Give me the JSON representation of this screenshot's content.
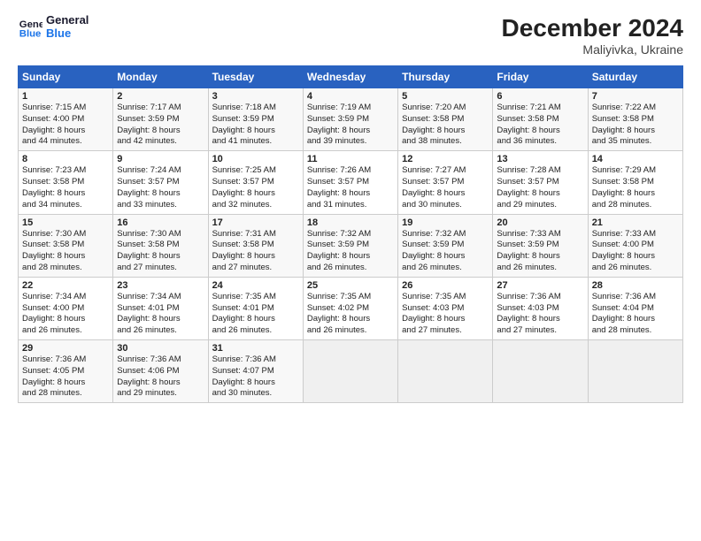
{
  "header": {
    "logo_line1": "General",
    "logo_line2": "Blue",
    "title": "December 2024",
    "subtitle": "Maliyivka, Ukraine"
  },
  "days_of_week": [
    "Sunday",
    "Monday",
    "Tuesday",
    "Wednesday",
    "Thursday",
    "Friday",
    "Saturday"
  ],
  "weeks": [
    [
      {
        "day": "1",
        "info": "Sunrise: 7:15 AM\nSunset: 4:00 PM\nDaylight: 8 hours\nand 44 minutes."
      },
      {
        "day": "2",
        "info": "Sunrise: 7:17 AM\nSunset: 3:59 PM\nDaylight: 8 hours\nand 42 minutes."
      },
      {
        "day": "3",
        "info": "Sunrise: 7:18 AM\nSunset: 3:59 PM\nDaylight: 8 hours\nand 41 minutes."
      },
      {
        "day": "4",
        "info": "Sunrise: 7:19 AM\nSunset: 3:59 PM\nDaylight: 8 hours\nand 39 minutes."
      },
      {
        "day": "5",
        "info": "Sunrise: 7:20 AM\nSunset: 3:58 PM\nDaylight: 8 hours\nand 38 minutes."
      },
      {
        "day": "6",
        "info": "Sunrise: 7:21 AM\nSunset: 3:58 PM\nDaylight: 8 hours\nand 36 minutes."
      },
      {
        "day": "7",
        "info": "Sunrise: 7:22 AM\nSunset: 3:58 PM\nDaylight: 8 hours\nand 35 minutes."
      }
    ],
    [
      {
        "day": "8",
        "info": "Sunrise: 7:23 AM\nSunset: 3:58 PM\nDaylight: 8 hours\nand 34 minutes."
      },
      {
        "day": "9",
        "info": "Sunrise: 7:24 AM\nSunset: 3:57 PM\nDaylight: 8 hours\nand 33 minutes."
      },
      {
        "day": "10",
        "info": "Sunrise: 7:25 AM\nSunset: 3:57 PM\nDaylight: 8 hours\nand 32 minutes."
      },
      {
        "day": "11",
        "info": "Sunrise: 7:26 AM\nSunset: 3:57 PM\nDaylight: 8 hours\nand 31 minutes."
      },
      {
        "day": "12",
        "info": "Sunrise: 7:27 AM\nSunset: 3:57 PM\nDaylight: 8 hours\nand 30 minutes."
      },
      {
        "day": "13",
        "info": "Sunrise: 7:28 AM\nSunset: 3:57 PM\nDaylight: 8 hours\nand 29 minutes."
      },
      {
        "day": "14",
        "info": "Sunrise: 7:29 AM\nSunset: 3:58 PM\nDaylight: 8 hours\nand 28 minutes."
      }
    ],
    [
      {
        "day": "15",
        "info": "Sunrise: 7:30 AM\nSunset: 3:58 PM\nDaylight: 8 hours\nand 28 minutes."
      },
      {
        "day": "16",
        "info": "Sunrise: 7:30 AM\nSunset: 3:58 PM\nDaylight: 8 hours\nand 27 minutes."
      },
      {
        "day": "17",
        "info": "Sunrise: 7:31 AM\nSunset: 3:58 PM\nDaylight: 8 hours\nand 27 minutes."
      },
      {
        "day": "18",
        "info": "Sunrise: 7:32 AM\nSunset: 3:59 PM\nDaylight: 8 hours\nand 26 minutes."
      },
      {
        "day": "19",
        "info": "Sunrise: 7:32 AM\nSunset: 3:59 PM\nDaylight: 8 hours\nand 26 minutes."
      },
      {
        "day": "20",
        "info": "Sunrise: 7:33 AM\nSunset: 3:59 PM\nDaylight: 8 hours\nand 26 minutes."
      },
      {
        "day": "21",
        "info": "Sunrise: 7:33 AM\nSunset: 4:00 PM\nDaylight: 8 hours\nand 26 minutes."
      }
    ],
    [
      {
        "day": "22",
        "info": "Sunrise: 7:34 AM\nSunset: 4:00 PM\nDaylight: 8 hours\nand 26 minutes."
      },
      {
        "day": "23",
        "info": "Sunrise: 7:34 AM\nSunset: 4:01 PM\nDaylight: 8 hours\nand 26 minutes."
      },
      {
        "day": "24",
        "info": "Sunrise: 7:35 AM\nSunset: 4:01 PM\nDaylight: 8 hours\nand 26 minutes."
      },
      {
        "day": "25",
        "info": "Sunrise: 7:35 AM\nSunset: 4:02 PM\nDaylight: 8 hours\nand 26 minutes."
      },
      {
        "day": "26",
        "info": "Sunrise: 7:35 AM\nSunset: 4:03 PM\nDaylight: 8 hours\nand 27 minutes."
      },
      {
        "day": "27",
        "info": "Sunrise: 7:36 AM\nSunset: 4:03 PM\nDaylight: 8 hours\nand 27 minutes."
      },
      {
        "day": "28",
        "info": "Sunrise: 7:36 AM\nSunset: 4:04 PM\nDaylight: 8 hours\nand 28 minutes."
      }
    ],
    [
      {
        "day": "29",
        "info": "Sunrise: 7:36 AM\nSunset: 4:05 PM\nDaylight: 8 hours\nand 28 minutes."
      },
      {
        "day": "30",
        "info": "Sunrise: 7:36 AM\nSunset: 4:06 PM\nDaylight: 8 hours\nand 29 minutes."
      },
      {
        "day": "31",
        "info": "Sunrise: 7:36 AM\nSunset: 4:07 PM\nDaylight: 8 hours\nand 30 minutes."
      },
      {
        "day": "",
        "info": ""
      },
      {
        "day": "",
        "info": ""
      },
      {
        "day": "",
        "info": ""
      },
      {
        "day": "",
        "info": ""
      }
    ]
  ]
}
